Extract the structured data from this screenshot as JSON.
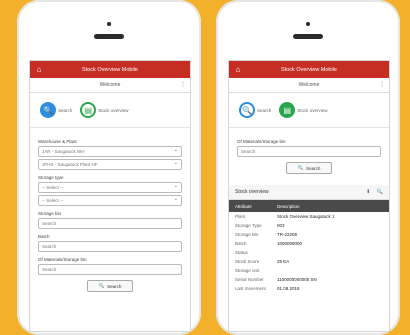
{
  "left": {
    "app_title": "Stock Overview Mobile",
    "subtitle": "Welcome",
    "tabs": [
      {
        "label": "Search"
      },
      {
        "label": "Stock overview"
      }
    ],
    "fields": [
      {
        "label": "Warehouse & Plant",
        "values": [
          "JAR - Saugatuck WH",
          "JPHX - Saugatuck Plant HF"
        ]
      },
      {
        "label": "Storage type",
        "values": [
          "-- Select --",
          "-- Select --"
        ]
      },
      {
        "label": "Storage bin",
        "values": [
          "Search"
        ]
      },
      {
        "label": "Batch",
        "values": [
          "Search"
        ]
      },
      {
        "label": "Of Materials/Storage bin",
        "values": [
          "Search"
        ]
      }
    ],
    "search_button": "Search"
  },
  "right": {
    "app_title": "Stock Overview Mobile",
    "subtitle": "Welcome",
    "tabs": [
      {
        "label": "Search"
      },
      {
        "label": "Stock overview"
      }
    ],
    "input_label": "Of Materials/Storage bin",
    "input_value": "Search",
    "search_button": "Search",
    "results_title": "Stock overview",
    "table_header": {
      "col1": "Attribute",
      "col2": "Description"
    },
    "rows": [
      {
        "k": "Plant",
        "v": "Stock Overview Saugatuck 1"
      },
      {
        "k": "Storage Type",
        "v": "003"
      },
      {
        "k": "Storage Bin",
        "v": "TR-22208"
      },
      {
        "k": "Batch",
        "v": "1000008000"
      },
      {
        "k": "Status",
        "v": ""
      },
      {
        "k": "Stock Score",
        "v": "25 EA"
      },
      {
        "k": "Storage unit",
        "v": ""
      },
      {
        "k": "Serial Number",
        "v": "1100000000000 SN"
      },
      {
        "k": "Last movement",
        "v": "01.08.2018"
      }
    ]
  }
}
